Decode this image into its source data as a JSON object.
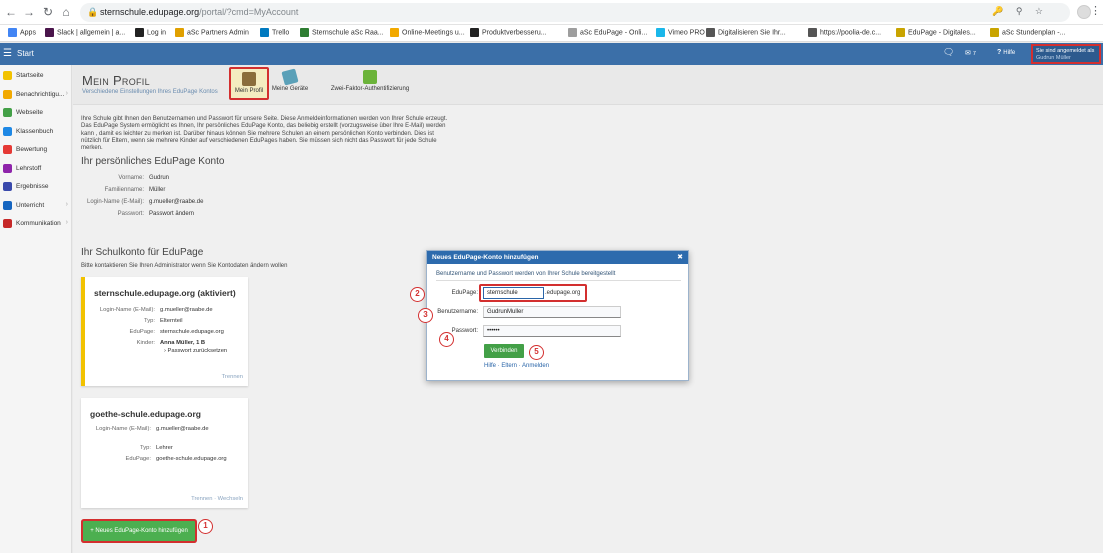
{
  "browser": {
    "url_host": "sternschule.edupage.org",
    "url_path": "/portal/?cmd=MyAccount"
  },
  "bookmarks": [
    {
      "label": "Apps",
      "color": "#4285f4"
    },
    {
      "label": "Slack | allgemein | a...",
      "color": "#4a154b"
    },
    {
      "label": "Log in",
      "color": "#222222"
    },
    {
      "label": "aSc Partners Admin",
      "color": "#e0a000"
    },
    {
      "label": "Trello",
      "color": "#0079bf"
    },
    {
      "label": "Sternschule aSc Raa...",
      "color": "#2e7d32"
    },
    {
      "label": "Online-Meetings u...",
      "color": "#f2a900"
    },
    {
      "label": "Produktverbesseru...",
      "color": "#222222"
    },
    {
      "label": "aSc EduPage - Onli...",
      "color": "#9e9e9e"
    },
    {
      "label": "Vimeo PRO",
      "color": "#1ab7ea"
    },
    {
      "label": "Digitalisieren Sie Ihr...",
      "color": "#555555"
    },
    {
      "label": "https://poolia-de.c...",
      "color": "#555555"
    },
    {
      "label": "EduPage - Digitales...",
      "color": "#c9a400"
    },
    {
      "label": "aSc Stundenplan -...",
      "color": "#c9a400"
    }
  ],
  "header": {
    "start": "Start",
    "mail_count": "7",
    "help": "Hilfe",
    "logged_in_label": "Sie sind angemeldet als",
    "logged_in_user": "Gudrun Müller"
  },
  "sidebar": {
    "items": [
      {
        "label": "Startseite",
        "color": "#f2c200",
        "arrow": false
      },
      {
        "label": "Benachrichtigu...",
        "color": "#f2a900",
        "arrow": true
      },
      {
        "label": "Webseite",
        "color": "#43a047",
        "arrow": false
      },
      {
        "label": "Klassenbuch",
        "color": "#1e88e5",
        "arrow": false
      },
      {
        "label": "Bewertung",
        "color": "#e53935",
        "arrow": false
      },
      {
        "label": "Lehrstoff",
        "color": "#8e24aa",
        "arrow": false
      },
      {
        "label": "Ergebnisse",
        "color": "#3949ab",
        "arrow": false
      },
      {
        "label": "Unterricht",
        "color": "#1565c0",
        "arrow": true
      },
      {
        "label": "Kommunikation",
        "color": "#c62828",
        "arrow": true
      }
    ]
  },
  "page": {
    "title": "Mein Profil",
    "subtitle": "Verschiedene Einstellungen Ihres EduPage Kontos",
    "tabs": [
      {
        "label": "Mein Profil",
        "active": true
      },
      {
        "label": "Meine Geräte",
        "active": false
      },
      {
        "label": "Zwei-Faktor-Authentifizierung",
        "active": false
      }
    ],
    "intro": "Ihre Schule gibt Ihnen den Benutzernamen und Passwort für unsere Seite. Diese Anmeldeinformationen werden von Ihrer Schule erzeugt. Das EduPage System ermöglicht es Ihnen, Ihr persönliches EduPage Konto, das beliebig erstellt (vorzugsweise über Ihre E-Mail) werden kann , damit es leichter zu merken ist. Darüber hinaus können Sie mehrere Schulen an einem persönlichen Konto verbinden. Dies ist nützlich für Eltern, wenn sie mehrere Kinder auf verschiedenen EduPages haben. Sie müssen sich nicht das Passwort für jede Schule merken.",
    "personal_title": "Ihr persönliches EduPage Konto",
    "personal": {
      "first_name_label": "Vorname:",
      "first_name": "Gudrun",
      "last_name_label": "Familienname:",
      "last_name": "Müller",
      "login_label": "Login-Name (E-Mail):",
      "login": "g.mueller@raabe.de",
      "password_label": "Passwort:",
      "password_link": "Passwort ändern"
    },
    "school_title": "Ihr Schulkonto für EduPage",
    "school_sub": "Bitte kontaktieren Sie Ihren Administrator wenn Sie Kontodaten ändern wollen",
    "card1": {
      "title": "sternschule.edupage.org (aktiviert)",
      "login_label": "Login-Name (E-Mail):",
      "login": "g.mueller@raabe.de",
      "type_label": "Typ:",
      "type": "Elternteil",
      "edupage_label": "EduPage:",
      "edupage": "sternschule.edupage.org",
      "children_label": "Kinder:",
      "child": "Anna Müller, 1 B",
      "reset_link": "Passwort zurücksetzen",
      "footer": "Trennen"
    },
    "card2": {
      "title": "goethe-schule.edupage.org",
      "login_label": "Login-Name (E-Mail):",
      "login": "g.mueller@raabe.de",
      "type_label": "Typ:",
      "type": "Lehrer",
      "edupage_label": "EduPage:",
      "edupage": "goethe-schule.edupage.org",
      "footer": "Trennen · Wechseln"
    },
    "add_button": "+ Neues EduPage-Konto hinzufügen"
  },
  "dialog": {
    "title": "Neues EduPage-Konto hinzufügen",
    "desc": "Benutzername und Passwort werden von Ihrer Schule bereitgestellt",
    "edupage_label": "EduPage:",
    "edupage_value": "sternschule",
    "edupage_suffix": ".edupage.org",
    "username_label": "Benutzername:",
    "username_value": "GudrunMuller",
    "password_label": "Passwort:",
    "password_value": "••••••",
    "connect": "Verbinden",
    "links": "Hilfe · Eltern · Anmelden"
  },
  "badges": [
    "1",
    "2",
    "3",
    "4",
    "5"
  ]
}
